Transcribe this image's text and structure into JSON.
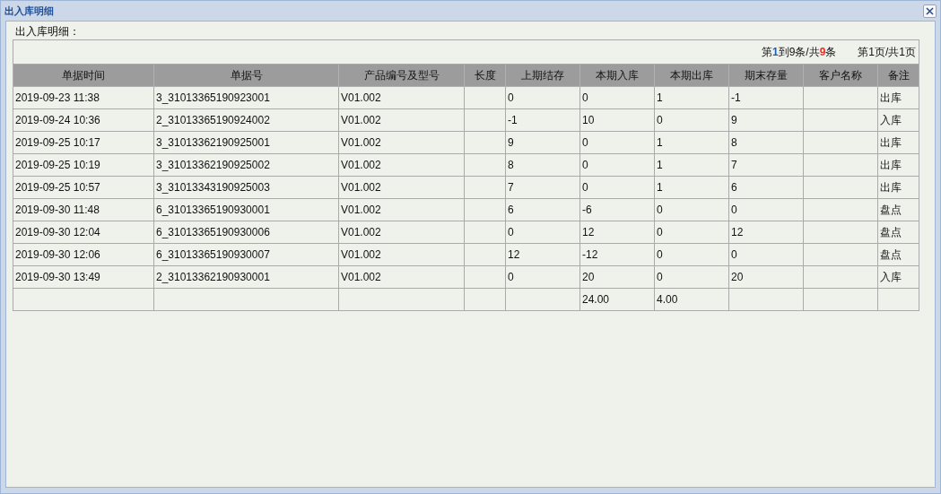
{
  "window": {
    "title": "出入库明细"
  },
  "section_label": "出入库明细：",
  "pager": {
    "range_parts": [
      {
        "text": "第"
      },
      {
        "text": "1",
        "color": "#1f5fa8"
      },
      {
        "text": "到"
      },
      {
        "text": "9"
      },
      {
        "text": "条/共"
      },
      {
        "text": "9",
        "color": "#e8322b"
      },
      {
        "text": "条"
      }
    ],
    "pages": "第1页/共1页"
  },
  "table": {
    "columns": [
      "单据时间",
      "单据号",
      "产品编号及型号",
      "长度",
      "上期结存",
      "本期入库",
      "本期出库",
      "期末存量",
      "客户名称",
      "备注"
    ],
    "rows": [
      {
        "time": "2019-09-23 11:38",
        "doc_no": "3_31013365190923001",
        "product": "V01.002",
        "prev_balance": "0",
        "period_in": "0",
        "period_out": "1",
        "end_balance": "-1",
        "note": "出库"
      },
      {
        "time": "2019-09-24 10:36",
        "doc_no": "2_31013365190924002",
        "product": "V01.002",
        "prev_balance": "-1",
        "period_in": "10",
        "period_out": "0",
        "end_balance": "9",
        "note": "入库"
      },
      {
        "time": "2019-09-25 10:17",
        "doc_no": "3_31013362190925001",
        "product": "V01.002",
        "prev_balance": "9",
        "period_in": "0",
        "period_out": "1",
        "end_balance": "8",
        "note": "出库"
      },
      {
        "time": "2019-09-25 10:19",
        "doc_no": "3_31013362190925002",
        "product": "V01.002",
        "prev_balance": "8",
        "period_in": "0",
        "period_out": "1",
        "end_balance": "7",
        "note": "出库"
      },
      {
        "time": "2019-09-25 10:57",
        "doc_no": "3_31013343190925003",
        "product": "V01.002",
        "prev_balance": "7",
        "period_in": "0",
        "period_out": "1",
        "end_balance": "6",
        "note": "出库"
      },
      {
        "time": "2019-09-30 11:48",
        "doc_no": "6_31013365190930001",
        "product": "V01.002",
        "prev_balance": "6",
        "period_in": "-6",
        "period_out": "0",
        "end_balance": "0",
        "note": "盘点"
      },
      {
        "time": "2019-09-30 12:04",
        "doc_no": "6_31013365190930006",
        "product": "V01.002",
        "prev_balance": "0",
        "period_in": "12",
        "period_out": "0",
        "end_balance": "12",
        "note": "盘点"
      },
      {
        "time": "2019-09-30 12:06",
        "doc_no": "6_31013365190930007",
        "product": "V01.002",
        "prev_balance": "12",
        "period_in": "-12",
        "period_out": "0",
        "end_balance": "0",
        "note": "盘点"
      },
      {
        "time": "2019-09-30 13:49",
        "doc_no": "2_31013362190930001",
        "product": "V01.002",
        "prev_balance": "0",
        "period_in": "20",
        "period_out": "0",
        "end_balance": "20",
        "note": "入库"
      }
    ],
    "totals": {
      "period_in": "24.00",
      "period_out": "4.00"
    }
  }
}
